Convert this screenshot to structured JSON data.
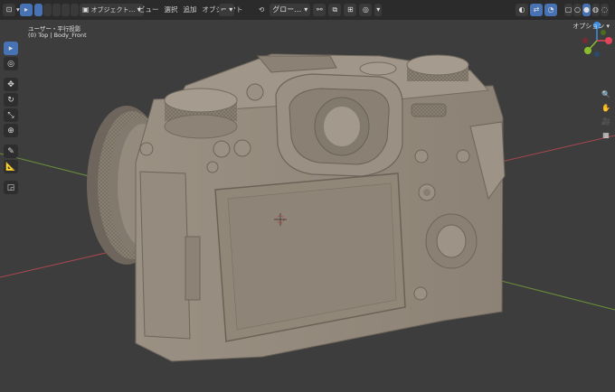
{
  "header": {
    "mode_label": "オブジェクト…",
    "menus": [
      "ビュー",
      "選択",
      "追加",
      "オブジェクト"
    ],
    "orientation_label": "グロー…",
    "options_label": "オプション"
  },
  "viewport": {
    "view_name": "ユーザー・平行投影",
    "collection_info": "(0) Top | Body_Front"
  },
  "gizmo": {
    "x_label": "X",
    "y_label": "Y",
    "z_label": "Z",
    "x_color": "#e3445a",
    "y_color": "#8bbb2e",
    "z_color": "#3b8ee0"
  },
  "tools": [
    "select-box",
    "cursor",
    "move",
    "rotate",
    "scale",
    "transform",
    "annotate",
    "measure",
    "add-cube"
  ],
  "colors": {
    "accent": "#4772b3",
    "background": "#3d3d3d",
    "model": "#948a7d"
  }
}
